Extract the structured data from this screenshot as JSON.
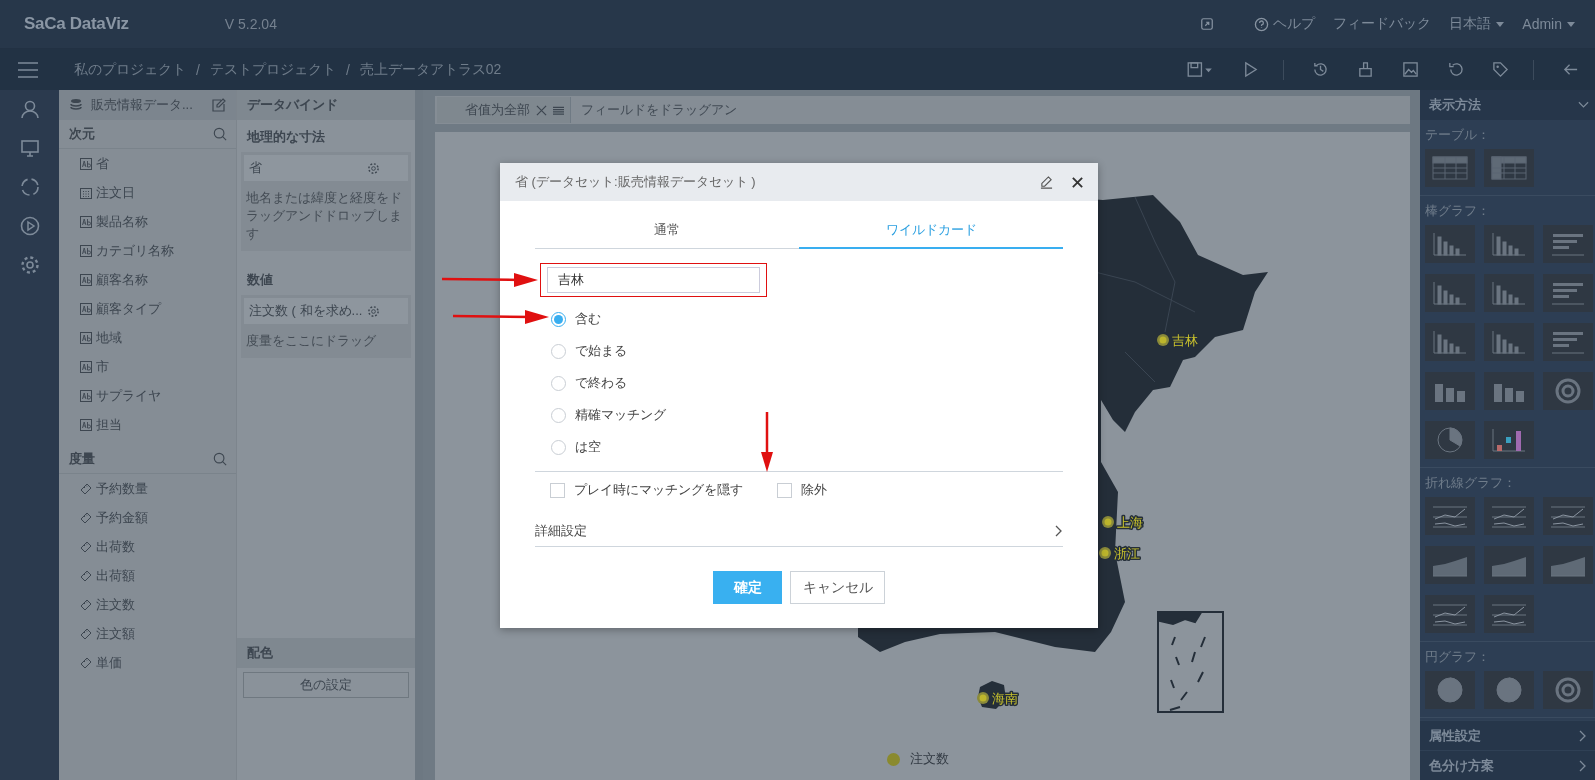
{
  "header": {
    "logo": "SaCa DataViz",
    "version": "V 5.2.04",
    "help": "ヘルプ",
    "feedback": "フィードバック",
    "language": "日本語",
    "user": "Admin"
  },
  "breadcrumb": [
    {
      "label": "私のプロジェクト",
      "kind": "link"
    },
    {
      "label": "/",
      "kind": "separator"
    },
    {
      "label": "テストプロジェクト",
      "kind": "link"
    },
    {
      "label": "/",
      "kind": "separator"
    },
    {
      "label": "売上データアトラス02",
      "kind": "current"
    }
  ],
  "dataset": {
    "name": "販売情報データ..."
  },
  "dimensions": {
    "title": "次元",
    "items": [
      {
        "label": "省",
        "kind": "text"
      },
      {
        "label": "注文日",
        "kind": "date"
      },
      {
        "label": "製品名称",
        "kind": "text"
      },
      {
        "label": "カテゴリ名称",
        "kind": "text"
      },
      {
        "label": "顧客名称",
        "kind": "text"
      },
      {
        "label": "顧客タイプ",
        "kind": "text"
      },
      {
        "label": "地域",
        "kind": "text"
      },
      {
        "label": "市",
        "kind": "text"
      },
      {
        "label": "サプライヤ",
        "kind": "text"
      },
      {
        "label": "担当",
        "kind": "text"
      }
    ]
  },
  "measures": {
    "title": "度量",
    "items": [
      "予約数量",
      "予約金額",
      "出荷数",
      "出荷額",
      "注文数",
      "注文額",
      "単価"
    ]
  },
  "databind": {
    "title": "データバインド",
    "sections": [
      {
        "title": "地理的な寸法",
        "field": "省",
        "hint": "地名または緯度と経度をドラッグアンドドロップします"
      },
      {
        "title": "数値",
        "field": "注文数 ( 和を求め...",
        "hint": "度量をここにドラッグ"
      }
    ],
    "color_title": "配色",
    "color_button": "色の設定"
  },
  "filter_bar": {
    "chip": "省值为全部",
    "placeholder": "フィールドをドラッグアン"
  },
  "map": {
    "markers": [
      "吉林",
      "上海",
      "浙江",
      "海南"
    ],
    "legend": "注文数"
  },
  "right_panel": {
    "title": "表示方法",
    "groups": [
      {
        "title": "テーブル：",
        "tiles": [
          {
            "kind": "table"
          },
          {
            "kind": "pivot"
          }
        ]
      },
      {
        "title": "棒グラフ：",
        "tiles": [
          {
            "kind": "bar"
          },
          {
            "kind": "bar"
          },
          {
            "kind": "hbar"
          },
          {
            "kind": "bar"
          },
          {
            "kind": "bar"
          },
          {
            "kind": "hbar"
          },
          {
            "kind": "bar"
          },
          {
            "kind": "bar"
          },
          {
            "kind": "hbar"
          },
          {
            "kind": "bar3d"
          },
          {
            "kind": "bar3d"
          },
          {
            "kind": "ring"
          },
          {
            "kind": "polar"
          },
          {
            "kind": "waterfall"
          }
        ]
      },
      {
        "title": "折れ線グラフ：",
        "tiles": [
          {
            "kind": "line"
          },
          {
            "kind": "line"
          },
          {
            "kind": "line"
          },
          {
            "kind": "area"
          },
          {
            "kind": "area"
          },
          {
            "kind": "area"
          },
          {
            "kind": "line"
          },
          {
            "kind": "line"
          }
        ]
      },
      {
        "title": "円グラフ：",
        "tiles": [
          {
            "kind": "pie"
          },
          {
            "kind": "pie"
          },
          {
            "kind": "donut"
          }
        ]
      }
    ],
    "footer": [
      "属性設定",
      "色分け方案"
    ]
  },
  "dialog": {
    "title": "省 (データセット:販売情報データセット )",
    "tabs": [
      {
        "label": "通常",
        "selected": false
      },
      {
        "label": "ワイルドカード",
        "selected": true
      }
    ],
    "value": "吉林",
    "options": [
      {
        "label": "含む",
        "selected": true
      },
      {
        "label": "で始まる",
        "selected": false
      },
      {
        "label": "で終わる",
        "selected": false
      },
      {
        "label": "精確マッチング",
        "selected": false
      },
      {
        "label": "は空",
        "selected": false
      }
    ],
    "checks": [
      {
        "label": "プレイ時にマッチングを隠す",
        "checked": false
      },
      {
        "label": "除外",
        "checked": false
      }
    ],
    "advanced": "詳細設定",
    "ok": "確定",
    "cancel": "キャンセル"
  }
}
